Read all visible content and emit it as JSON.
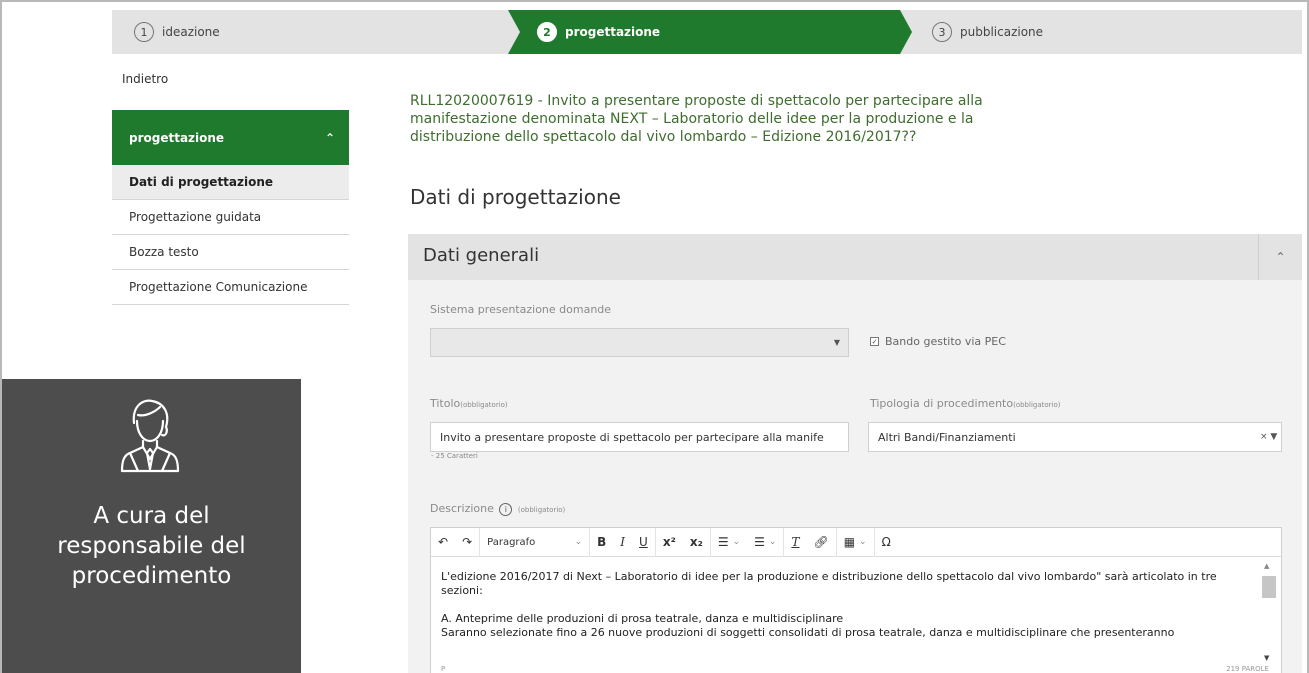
{
  "stepper": {
    "steps": [
      {
        "num": "1",
        "label": "ideazione"
      },
      {
        "num": "2",
        "label": "progettazione"
      },
      {
        "num": "3",
        "label": "pubblicazione"
      }
    ]
  },
  "sidebar": {
    "back": "Indietro",
    "header": "progettazione",
    "items": [
      {
        "label": "Dati di progettazione"
      },
      {
        "label": "Progettazione guidata"
      },
      {
        "label": "Bozza testo"
      },
      {
        "label": "Progettazione Comunicazione"
      }
    ]
  },
  "responsible_panel": {
    "caption_lines": [
      "A cura del",
      "responsabile del",
      "procedimento"
    ]
  },
  "main": {
    "notice_title": "RLL12020007619 - Invito a presentare proposte di spettacolo per partecipare alla manifestazione denominata NEXT – Laboratorio delle idee per la produzione e la distribuzione dello spettacolo dal vivo lombardo – Edizione 2016/2017??",
    "page_title": "Dati di progettazione",
    "section_title": "Dati generali"
  },
  "form": {
    "sistema_label": "Sistema presentazione domande",
    "sistema_value": "",
    "pec_checkbox_label": "Bando gestito via PEC",
    "pec_checked": true,
    "titolo_label": "Titolo",
    "required_tag": "(obbligatorio)",
    "titolo_value": "Invito a presentare proposte di spettacolo per partecipare alla manife",
    "titolo_chars": "- 25 Caratteri",
    "tipologia_label": "Tipologia di procedimento",
    "tipologia_value": "Altri Bandi/Finanziamenti",
    "descrizione_label": "Descrizione",
    "info_glyph": "i"
  },
  "editor": {
    "paragraph_select": "Paragrafo",
    "text": [
      "L'edizione 2016/2017 di  Next – Laboratorio di idee per la produzione e distribuzione dello spettacolo dal vivo lombardo\" sarà articolato in tre sezioni:",
      " A. Anteprime delle produzioni di prosa teatrale, danza e multidisciplinare",
      "Saranno selezionate fino a 26 nuove produzioni di soggetti consolidati di prosa teatrale, danza e multidisciplinare che presenteranno"
    ],
    "path": "P",
    "word_count": "219 PAROLE"
  }
}
